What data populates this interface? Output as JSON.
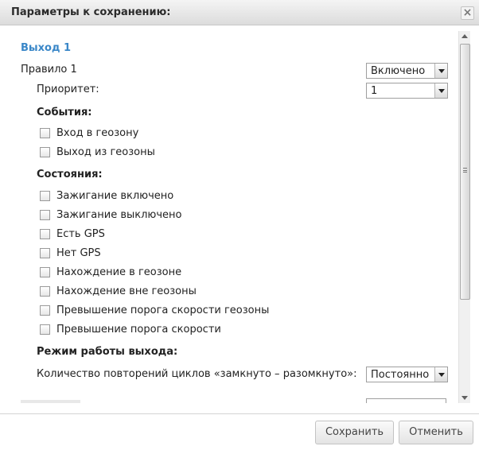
{
  "dialog": {
    "title": "Параметры к сохранению:",
    "close_glyph": "×"
  },
  "output": {
    "section_title": "Выход 1",
    "rule_label": "Правило 1",
    "rule_value": "Включено",
    "priority_label": "Приоритет:",
    "priority_value": "1"
  },
  "events": {
    "heading": "События:",
    "items": [
      {
        "label": "Вход в геозону",
        "checked": false
      },
      {
        "label": "Выход из геозоны",
        "checked": false
      }
    ]
  },
  "states": {
    "heading": "Состояния:",
    "items": [
      {
        "label": "Зажигание включено",
        "checked": false
      },
      {
        "label": "Зажигание выключено",
        "checked": false
      },
      {
        "label": "Есть GPS",
        "checked": false
      },
      {
        "label": "Нет GPS",
        "checked": false
      },
      {
        "label": "Нахождение в геозоне",
        "checked": false
      },
      {
        "label": "Нахождение вне геозоны",
        "checked": false
      },
      {
        "label": "Превышение порога скорости геозоны",
        "checked": false
      },
      {
        "label": "Превышение порога скорости",
        "checked": false
      }
    ]
  },
  "mode": {
    "heading": "Режим работы выхода:",
    "cycles_label": "Количество повторений циклов «замкнуто – разомкнуто»:",
    "cycles_value": "Постоянно"
  },
  "footer": {
    "save_label": "Сохранить",
    "cancel_label": "Отменить"
  },
  "colors": {
    "section_title": "#3a87c8",
    "titlebar": "#dcdcdc"
  }
}
